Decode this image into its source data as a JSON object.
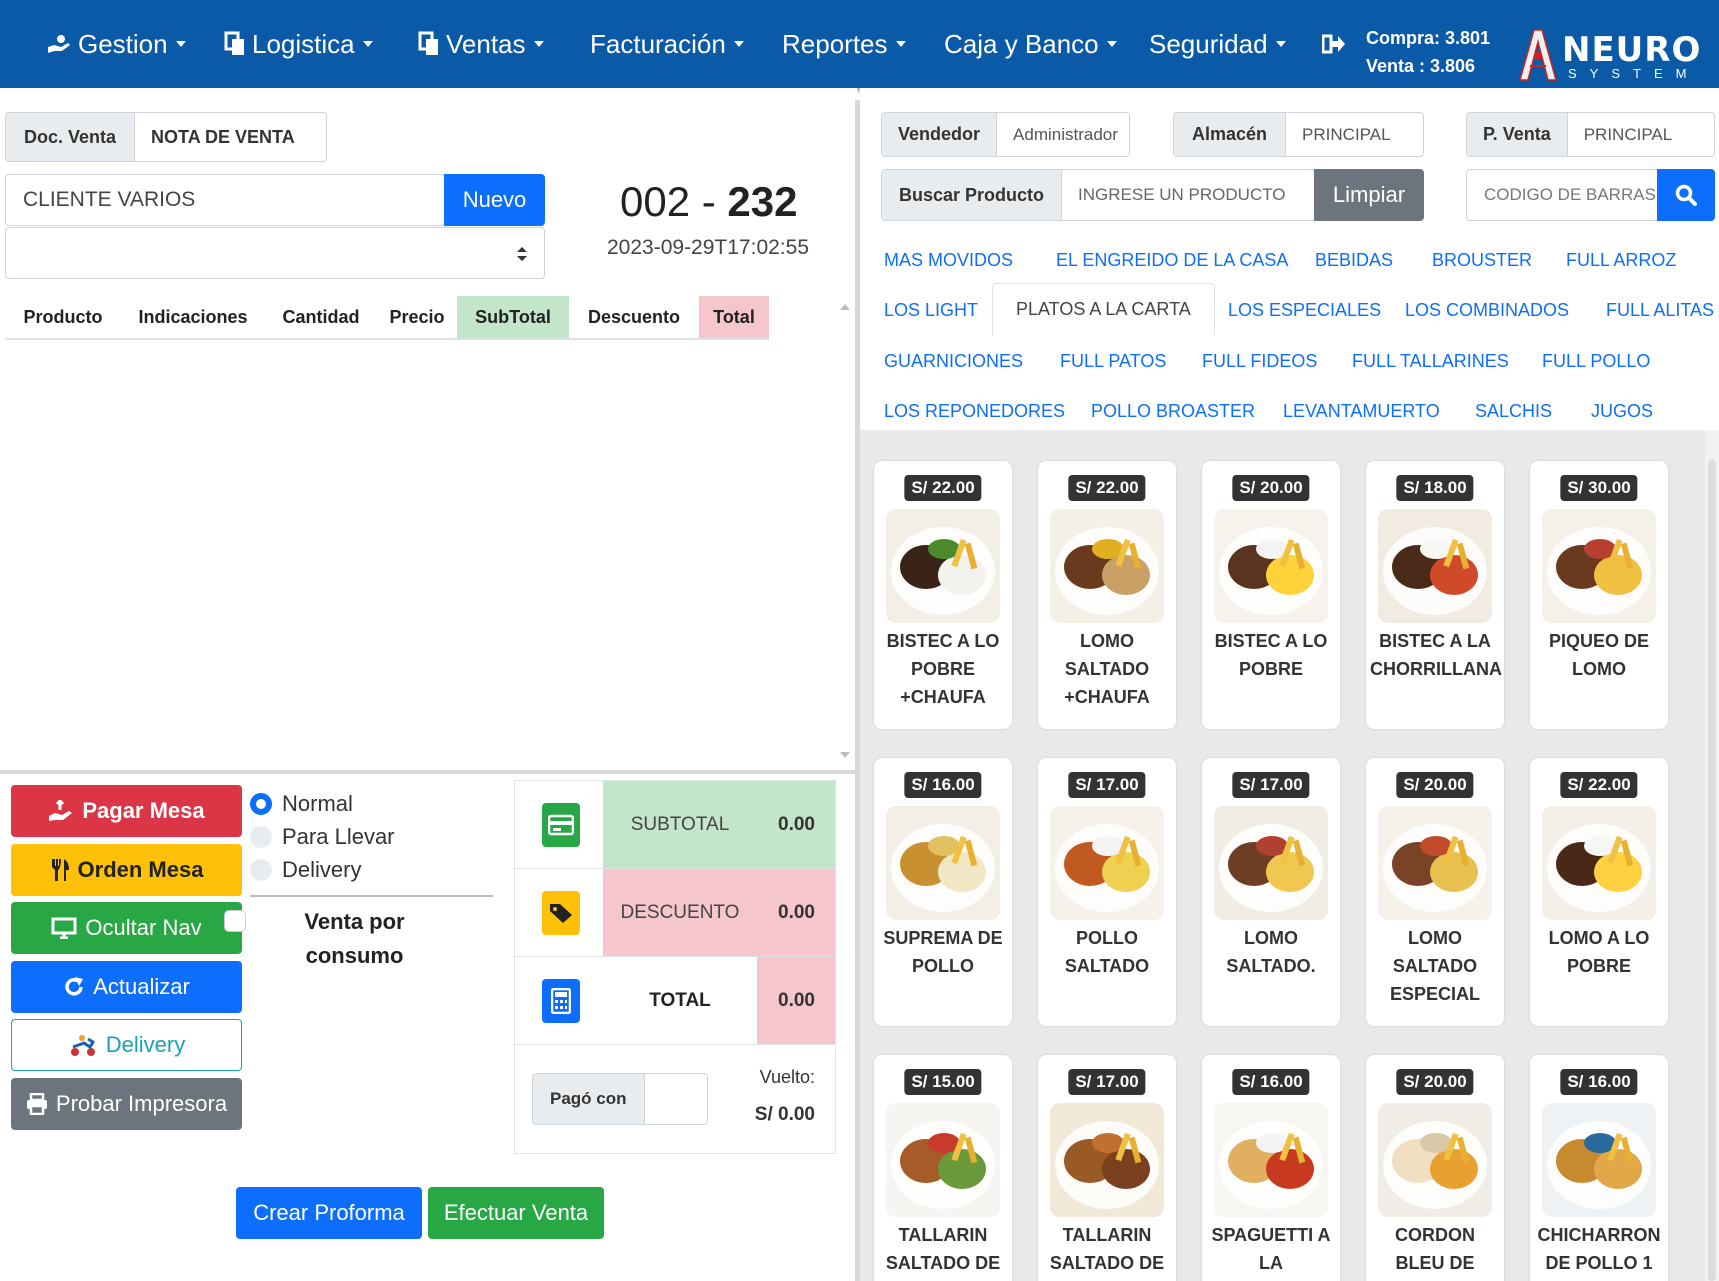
{
  "nav": {
    "items": [
      {
        "label": "Gestion",
        "icon": "hand-coins-icon"
      },
      {
        "label": "Logistica",
        "icon": "copy-icon"
      },
      {
        "label": "Ventas",
        "icon": "copy-icon"
      },
      {
        "label": "Facturación",
        "icon": ""
      },
      {
        "label": "Reportes",
        "icon": ""
      },
      {
        "label": "Caja y Banco",
        "icon": ""
      },
      {
        "label": "Seguridad",
        "icon": ""
      }
    ],
    "logout_icon": "sign-out-icon",
    "rate_compra": "Compra: 3.801",
    "rate_venta": "Venta : 3.806",
    "logo_main": "NEURO",
    "logo_sub": "SYSTEM"
  },
  "left": {
    "doc_label": "Doc. Venta",
    "doc_value": "NOTA DE VENTA",
    "client_value": "CLIENTE VARIOS",
    "new_button": "Nuevo",
    "doc_serie": "002",
    "doc_dash": "-",
    "doc_number": "232",
    "doc_date": "2023-09-29T17:02:55",
    "columns": [
      "Producto",
      "Indicaciones",
      "Cantidad",
      "Precio",
      "SubTotal",
      "Descuento",
      "Total"
    ],
    "actions": {
      "pagar": "Pagar Mesa",
      "orden": "Orden Mesa",
      "ocultar": "Ocultar Nav",
      "actualizar": "Actualizar",
      "delivery": "Delivery",
      "probar": "Probar Impresora"
    },
    "order_types": [
      "Normal",
      "Para Llevar",
      "Delivery"
    ],
    "consumo": "Venta por consumo",
    "totals": {
      "subtotal_label": "SUBTOTAL",
      "subtotal": "0.00",
      "descuento_label": "DESCUENTO",
      "descuento": "0.00",
      "total_label": "TOTAL",
      "total": "0.00",
      "pago_label": "Pagó con",
      "vuelto_label": "Vuelto:",
      "vuelto": "S/ 0.00"
    },
    "crear_proforma": "Crear Proforma",
    "efectuar_venta": "Efectuar Venta"
  },
  "right": {
    "vendedor_label": "Vendedor",
    "vendedor_value": "Administrador",
    "almacen_label": "Almacén",
    "almacen_value": "PRINCIPAL",
    "pventa_label": "P. Venta",
    "pventa_value": "PRINCIPAL",
    "buscar_label": "Buscar Producto",
    "buscar_placeholder": "INGRESE UN PRODUCTO",
    "limpiar": "Limpiar",
    "barras_placeholder": "CODIGO DE BARRAS",
    "categories": [
      "MAS MOVIDOS",
      "EL ENGREIDO DE LA CASA",
      "BEBIDAS",
      "BROUSTER",
      "FULL ARROZ",
      "LOS LIGHT",
      "PLATOS A LA CARTA",
      "LOS ESPECIALES",
      "LOS COMBINADOS",
      "FULL ALITAS",
      "GUARNICIONES",
      "FULL PATOS",
      "FULL FIDEOS",
      "FULL TALLARINES",
      "FULL POLLO",
      "LOS REPONEDORES",
      "POLLO BROASTER",
      "LEVANTAMUERTO",
      "SALCHIS",
      "JUGOS"
    ],
    "active_category": "PLATOS A LA CARTA",
    "products": [
      {
        "price": "S/ 22.00",
        "name": "BISTEC A LO POBRE +CHAUFA",
        "kind": "bistec"
      },
      {
        "price": "S/ 22.00",
        "name": "LOMO SALTADO +CHAUFA",
        "kind": "lomo-rice"
      },
      {
        "price": "S/ 20.00",
        "name": "BISTEC A LO POBRE",
        "kind": "bistec-egg"
      },
      {
        "price": "S/ 18.00",
        "name": "BISTEC A LA CHORRILLANA",
        "kind": "chorrillana"
      },
      {
        "price": "S/ 30.00",
        "name": "PIQUEO DE LOMO",
        "kind": "piqueo"
      },
      {
        "price": "S/ 16.00",
        "name": "SUPREMA DE POLLO",
        "kind": "suprema"
      },
      {
        "price": "S/ 17.00",
        "name": "POLLO SALTADO",
        "kind": "pollo-saltado"
      },
      {
        "price": "S/ 17.00",
        "name": "LOMO SALTADO.",
        "kind": "lomo"
      },
      {
        "price": "S/ 20.00",
        "name": "LOMO SALTADO ESPECIAL",
        "kind": "lomo-esp"
      },
      {
        "price": "S/ 22.00",
        "name": "LOMO A LO POBRE",
        "kind": "lomo-pobre"
      },
      {
        "price": "S/ 15.00",
        "name": "TALLARIN SALTADO DE POLLO",
        "kind": "tallarin"
      },
      {
        "price": "S/ 17.00",
        "name": "TALLARIN SALTADO DE RES",
        "kind": "tallarin2"
      },
      {
        "price": "S/ 16.00",
        "name": "SPAGUETTI A LA BOLOGNESA",
        "kind": "spaguetti"
      },
      {
        "price": "S/ 20.00",
        "name": "CORDON BLEU DE POLLO",
        "kind": "cordon"
      },
      {
        "price": "S/ 16.00",
        "name": "CHICHARRON DE POLLO 1",
        "kind": "chicharron"
      }
    ]
  },
  "colors": {
    "navbar": "#0b5aa8",
    "primary": "#0d6efd",
    "danger": "#dc3545",
    "warning": "#ffc107",
    "success": "#28a745",
    "secondary": "#6c757d",
    "info": "#17a2b8",
    "subtotal_bg": "#c3e6cb",
    "descuento_bg": "#f5c6cb"
  }
}
